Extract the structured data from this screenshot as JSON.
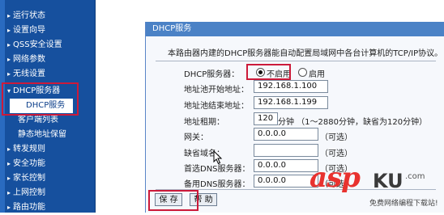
{
  "sidebar": {
    "items": [
      {
        "label": "运行状态",
        "arrow": "▸"
      },
      {
        "label": "设置向导",
        "arrow": "▸"
      },
      {
        "label": "QSS安全设置",
        "arrow": "▸"
      },
      {
        "label": "网络参数",
        "arrow": "▸"
      },
      {
        "label": "无线设置",
        "arrow": "▸"
      },
      {
        "label": "DHCP服务器",
        "arrow": "▾"
      },
      {
        "label": "DHCP服务",
        "arrow": "▸"
      },
      {
        "label": "客户端列表",
        "arrow": ""
      },
      {
        "label": "静态地址保留",
        "arrow": ""
      },
      {
        "label": "转发规则",
        "arrow": "▸"
      },
      {
        "label": "安全功能",
        "arrow": "▸"
      },
      {
        "label": "家长控制",
        "arrow": "▸"
      },
      {
        "label": "上网控制",
        "arrow": "▸"
      },
      {
        "label": "路由功能",
        "arrow": "▸"
      }
    ]
  },
  "panel": {
    "title": "DHCP服务",
    "description": "本路由器内建的DHCP服务器能自动配置局域网中各台计算机的TCP/IP协议。",
    "server_label": "DHCP服务器：",
    "radio_disable": "不启用",
    "radio_enable": "启用",
    "selected": "不启用",
    "start_label": "地址池开始地址：",
    "start_value": "192.168.1.100",
    "end_label": "地址池结束地址：",
    "end_value": "192.168.1.199",
    "lease_label": "地址租期：",
    "lease_value": "120",
    "lease_hint": "分钟 （1～2880分钟，缺省为120分钟）",
    "gateway_label": "网关：",
    "gateway_value": "0.0.0.0",
    "optional": "（可选）",
    "domain_label": "缺省域名：",
    "domain_value": "",
    "dns1_label": "首选DNS服务器：",
    "dns1_value": "0.0.0.0",
    "dns2_label": "备用DNS服务器：",
    "dns2_value": "0.0.0.0",
    "save_label": "保 存",
    "help_label": "帮 助"
  },
  "watermark": {
    "brand_asp": "asp",
    "brand_ku": "KU",
    "brand_com": ".com",
    "sub": "免费网络编程下载站!"
  },
  "colors": {
    "sidebar": "#16509e",
    "title_bar": "#4b82c6",
    "highlight": "#cc1a3a"
  }
}
